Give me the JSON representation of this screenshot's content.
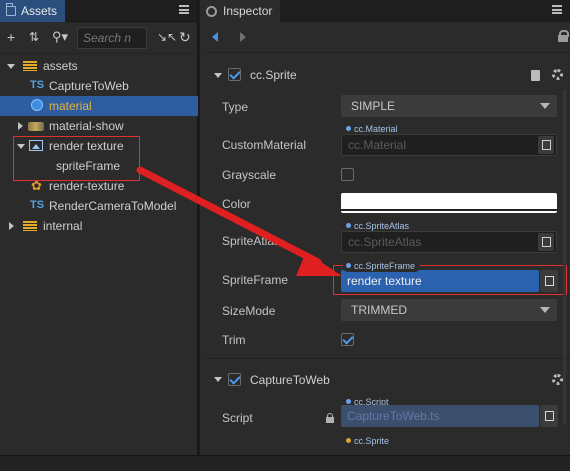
{
  "assets": {
    "tab_label": "Assets",
    "search_placeholder": "Search n",
    "tree": [
      {
        "label": "assets",
        "icon": "database-icon"
      },
      {
        "label": "CaptureToWeb",
        "icon": "typescript-icon",
        "prefix": "TS"
      },
      {
        "label": "material",
        "icon": "globe-icon",
        "selected": true
      },
      {
        "label": "material-show",
        "icon": "scene-icon"
      },
      {
        "label": "render texture",
        "icon": "image-icon"
      },
      {
        "label": "spriteFrame",
        "icon": ""
      },
      {
        "label": "render-texture",
        "icon": "flame-icon"
      },
      {
        "label": "RenderCameraToModel",
        "icon": "typescript-icon",
        "prefix": "TS"
      },
      {
        "label": "internal",
        "icon": "database-icon"
      }
    ]
  },
  "inspector": {
    "tab_label": "Inspector",
    "sprite": {
      "title": "cc.Sprite",
      "type_label": "Type",
      "type_value": "SIMPLE",
      "custom_material_label": "CustomMaterial",
      "custom_material_tag": "cc.Material",
      "custom_material_value": "cc.Material",
      "grayscale_label": "Grayscale",
      "color_label": "Color",
      "color_value": "#ffffff",
      "sprite_atlas_label": "SpriteAtlas",
      "sprite_atlas_tag": "cc.SpriteAtlas",
      "sprite_atlas_value": "cc.SpriteAtlas",
      "sprite_frame_label": "SpriteFrame",
      "sprite_frame_tag": "cc.SpriteFrame",
      "sprite_frame_value": "render texture",
      "size_mode_label": "SizeMode",
      "size_mode_value": "TRIMMED",
      "trim_label": "Trim"
    },
    "capture": {
      "title": "CaptureToWeb",
      "script_label": "Script",
      "script_tag": "cc.Script",
      "script_value": "CaptureToWeb.ts",
      "next_tag": "cc.Sprite"
    }
  },
  "colors": {
    "accent": "#2e5e9f",
    "annotation": "#e03030",
    "selected_text": "#e6b43e"
  }
}
